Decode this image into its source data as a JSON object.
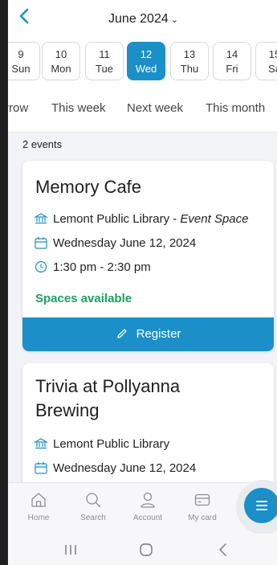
{
  "header": {
    "title": "June 2024",
    "back_icon": "chevron-left-icon",
    "dropdown_icon": "chevron-down-icon",
    "accent": "#1a8fc8"
  },
  "days": [
    {
      "num": "9",
      "dow": "Sun",
      "selected": false
    },
    {
      "num": "10",
      "dow": "Mon",
      "selected": false
    },
    {
      "num": "11",
      "dow": "Tue",
      "selected": false
    },
    {
      "num": "12",
      "dow": "Wed",
      "selected": true
    },
    {
      "num": "13",
      "dow": "Thu",
      "selected": false
    },
    {
      "num": "14",
      "dow": "Fri",
      "selected": false
    },
    {
      "num": "15",
      "dow": "Sa",
      "selected": false
    }
  ],
  "ranges": [
    "rrow",
    "This week",
    "Next week",
    "This month"
  ],
  "events_count": "2 events",
  "events": [
    {
      "title": "Memory Cafe",
      "location": "Lemont Public Library",
      "room": "Event Space",
      "location_sep": " - ",
      "date": "Wednesday June 12, 2024",
      "time": "1:30 pm - 2:30 pm",
      "availability": "Spaces available",
      "register_label": "Register"
    },
    {
      "title": "Trivia at Pollyanna Brewing",
      "location": "Lemont Public Library",
      "date": "Wednesday June 12, 2024"
    }
  ],
  "tabs": [
    {
      "label": "Home",
      "icon": "home-icon"
    },
    {
      "label": "Search",
      "icon": "search-icon"
    },
    {
      "label": "Account",
      "icon": "account-icon"
    },
    {
      "label": "My card",
      "icon": "card-icon"
    }
  ],
  "fab": {
    "icon": "menu-icon"
  },
  "status_colors": {
    "available": "#1f9e63"
  }
}
